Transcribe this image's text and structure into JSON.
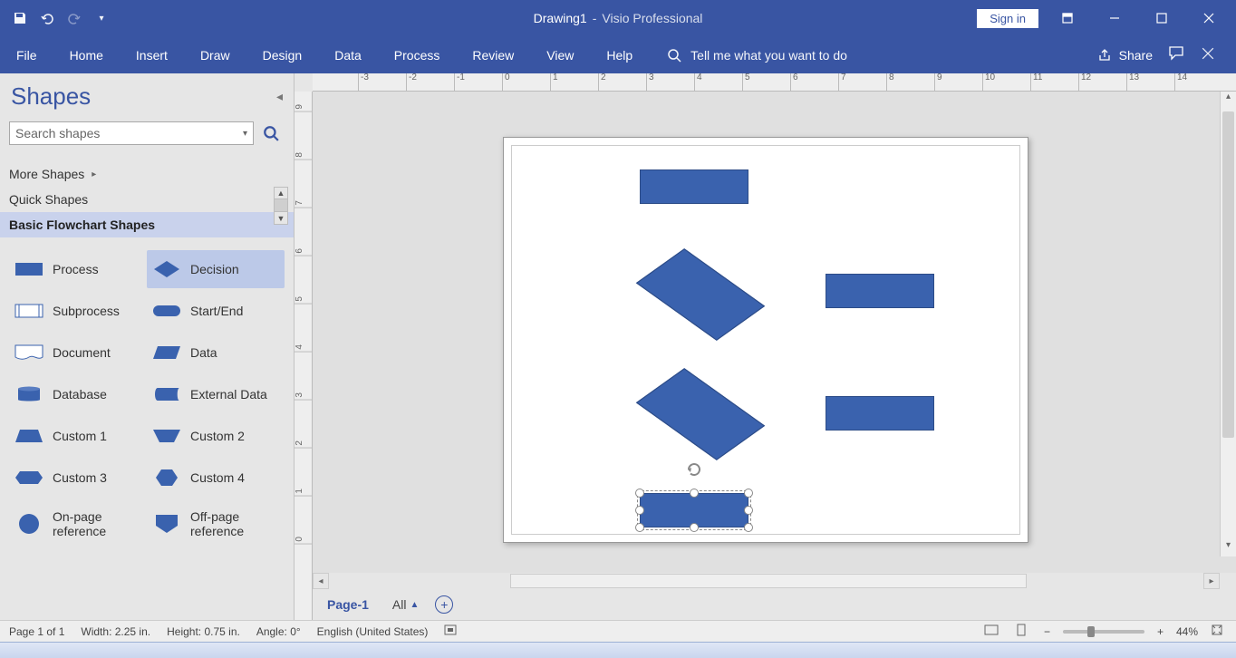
{
  "title": {
    "doc": "Drawing1",
    "sep": "-",
    "app": "Visio Professional"
  },
  "signin": "Sign in",
  "ribbon": {
    "tabs": [
      "File",
      "Home",
      "Insert",
      "Draw",
      "Design",
      "Data",
      "Process",
      "Review",
      "View",
      "Help"
    ],
    "tellme": "Tell me what you want to do",
    "share": "Share"
  },
  "shapes_pane": {
    "title": "Shapes",
    "search_placeholder": "Search shapes",
    "more": "More Shapes",
    "quick": "Quick Shapes",
    "active_stencil": "Basic Flowchart Shapes",
    "items": [
      {
        "label": "Process",
        "type": "rect"
      },
      {
        "label": "Decision",
        "type": "diamond"
      },
      {
        "label": "Subprocess",
        "type": "subproc"
      },
      {
        "label": "Start/End",
        "type": "pill"
      },
      {
        "label": "Document",
        "type": "doc"
      },
      {
        "label": "Data",
        "type": "para"
      },
      {
        "label": "Database",
        "type": "db"
      },
      {
        "label": "External Data",
        "type": "cyl"
      },
      {
        "label": "Custom 1",
        "type": "trap1"
      },
      {
        "label": "Custom 2",
        "type": "trap2"
      },
      {
        "label": "Custom 3",
        "type": "hex1"
      },
      {
        "label": "Custom 4",
        "type": "hex2"
      },
      {
        "label": "On-page reference",
        "type": "circle"
      },
      {
        "label": "Off-page reference",
        "type": "offpage"
      }
    ]
  },
  "ruler_h": [
    "-3",
    "-2",
    "-1",
    "0",
    "1",
    "2",
    "3",
    "4",
    "5",
    "6",
    "7",
    "8",
    "9",
    "10",
    "11",
    "12",
    "13",
    "14"
  ],
  "ruler_v": [
    "9",
    "8",
    "7",
    "6",
    "5",
    "4",
    "3",
    "2",
    "1",
    "0"
  ],
  "page_tabs": {
    "active": "Page-1",
    "all": "All"
  },
  "status": {
    "page": "Page 1 of 1",
    "width": "Width: 2.25 in.",
    "height": "Height: 0.75 in.",
    "angle": "Angle: 0°",
    "lang": "English (United States)",
    "zoom": "44%"
  },
  "colors": {
    "accent": "#3955a3",
    "shape": "#3a62ae"
  }
}
